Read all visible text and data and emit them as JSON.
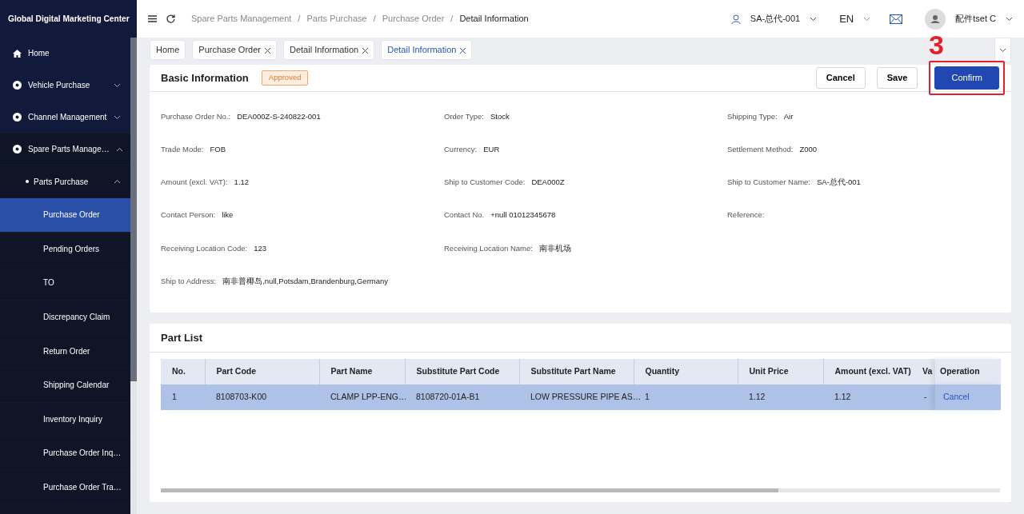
{
  "app_title": "Global Digital Marketing Center",
  "sidebar": {
    "items": [
      {
        "label": "Home",
        "kind": "home",
        "expanded": false
      },
      {
        "label": "Vehicle Purchase",
        "kind": "group",
        "expanded": false
      },
      {
        "label": "Channel Management",
        "kind": "group",
        "expanded": false
      },
      {
        "label": "Spare Parts Manage…",
        "kind": "group",
        "expanded": true,
        "children": [
          {
            "label": "Parts Purchase",
            "expanded": true,
            "children": [
              {
                "label": "Purchase Order",
                "selected": true
              },
              {
                "label": "Pending Orders",
                "selected": false
              },
              {
                "label": "TO",
                "selected": false
              },
              {
                "label": "Discrepancy Claim",
                "selected": false
              },
              {
                "label": "Return Order",
                "selected": false
              },
              {
                "label": "Shipping Calendar",
                "selected": false
              },
              {
                "label": "Inventory Inquiry",
                "selected": false
              },
              {
                "label": "Purchase Order Inq…",
                "selected": false
              },
              {
                "label": "Purchase Order Tra…",
                "selected": false
              }
            ]
          }
        ]
      }
    ]
  },
  "breadcrumb_separator": "/",
  "breadcrumb": [
    "Spare Parts Management",
    "Parts Purchase",
    "Purchase Order",
    "Detail Information"
  ],
  "header": {
    "account": "SA-总代-001",
    "language": "EN",
    "user": "配件tset C"
  },
  "tabs": [
    {
      "label": "Home",
      "closable": false,
      "selected": false
    },
    {
      "label": "Purchase Order",
      "closable": true,
      "selected": false
    },
    {
      "label": "Detail Information",
      "closable": true,
      "selected": false
    },
    {
      "label": "Detail Information",
      "closable": true,
      "selected": true
    }
  ],
  "basic_info": {
    "title": "Basic Information",
    "status": "Approved",
    "buttons": [
      {
        "label": "Cancel",
        "kind": "default"
      },
      {
        "label": "Save",
        "kind": "default"
      },
      {
        "label": "Confirm",
        "kind": "primary"
      }
    ],
    "fields": [
      {
        "label": "Purchase Order No.:",
        "value": "DEA000Z-S-240822-001"
      },
      {
        "label": "Order Type:",
        "value": "Stock"
      },
      {
        "label": "Shipping Type:",
        "value": "Air"
      },
      {
        "label": "Trade Mode:",
        "value": "FOB"
      },
      {
        "label": "Currency:",
        "value": "EUR"
      },
      {
        "label": "Settlement Method:",
        "value": "Z000"
      },
      {
        "label": "Amount (excl. VAT):",
        "value": "1.12"
      },
      {
        "label": "Ship to Customer Code:",
        "value": "DEA000Z"
      },
      {
        "label": "Ship to Customer Name:",
        "value": "SA-总代-001"
      },
      {
        "label": "Contact Person:",
        "value": "like"
      },
      {
        "label": "Contact No.",
        "value": "+null 01012345678"
      },
      {
        "label": "Reference:"
      },
      {
        "label": "Receiving Location Code:",
        "value": "123"
      },
      {
        "label": "Receiving Location Name:",
        "value": "南非机场"
      },
      {
        "label": "Ship to Address:",
        "kind": "new_row",
        "value": "南非普椰岛,null,Potsdam,Brandenburg,Germany"
      }
    ]
  },
  "annotation": {
    "label": "3"
  },
  "part_list": {
    "title": "Part List",
    "columns": [
      "No.",
      "Part Code",
      "Part Name",
      "Substitute Part Code",
      "Substitute Part Name",
      "Quantity",
      "Unit Price",
      "Amount (excl. VAT)",
      "Va",
      "Operation"
    ],
    "rows": [
      {
        "selected": true,
        "cells": [
          "1",
          "8108703-K00",
          "CLAMP LPP-ENG…",
          "8108720-01A-B1",
          "LOW PRESSURE PIPE AS…",
          "1",
          "1.12",
          "1.12",
          "-"
        ],
        "action": "Cancel"
      }
    ]
  }
}
